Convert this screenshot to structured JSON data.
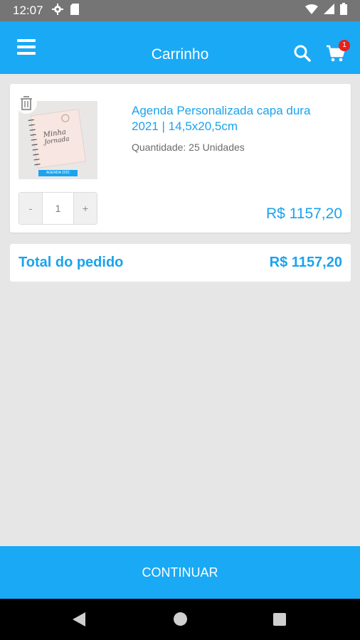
{
  "status_bar": {
    "time": "12:07",
    "icons": [
      "settings-gear-icon",
      "sd-card-icon",
      "wifi-icon",
      "signal-icon",
      "battery-icon"
    ]
  },
  "app_bar": {
    "title": "Carrinho",
    "menu_icon": "hamburger-menu-icon",
    "search_icon": "search-icon",
    "cart_icon": "shopping-cart-icon",
    "cart_badge": "1"
  },
  "cart_item": {
    "title": "Agenda Personalizada capa dura 2021 | 14,5x20,5cm",
    "quantity_text": "Quantidade: 25 Unidades",
    "stepper": {
      "minus": "-",
      "value": "1",
      "plus": "+"
    },
    "price": "R$ 1157,20",
    "delete_icon": "trash-icon",
    "image_label": "AGENDA 2021"
  },
  "total": {
    "label": "Total do pedido",
    "value": "R$ 1157,20"
  },
  "continue_button": "CONTINUAR",
  "colors": {
    "primary": "#1aa9f5",
    "text_accent": "#1aa3ee",
    "badge": "#e8201a",
    "status_bar": "#757575",
    "background": "#e6e6e6"
  },
  "nav_bar": {
    "icons": [
      "back-icon",
      "home-icon",
      "recents-icon"
    ]
  }
}
